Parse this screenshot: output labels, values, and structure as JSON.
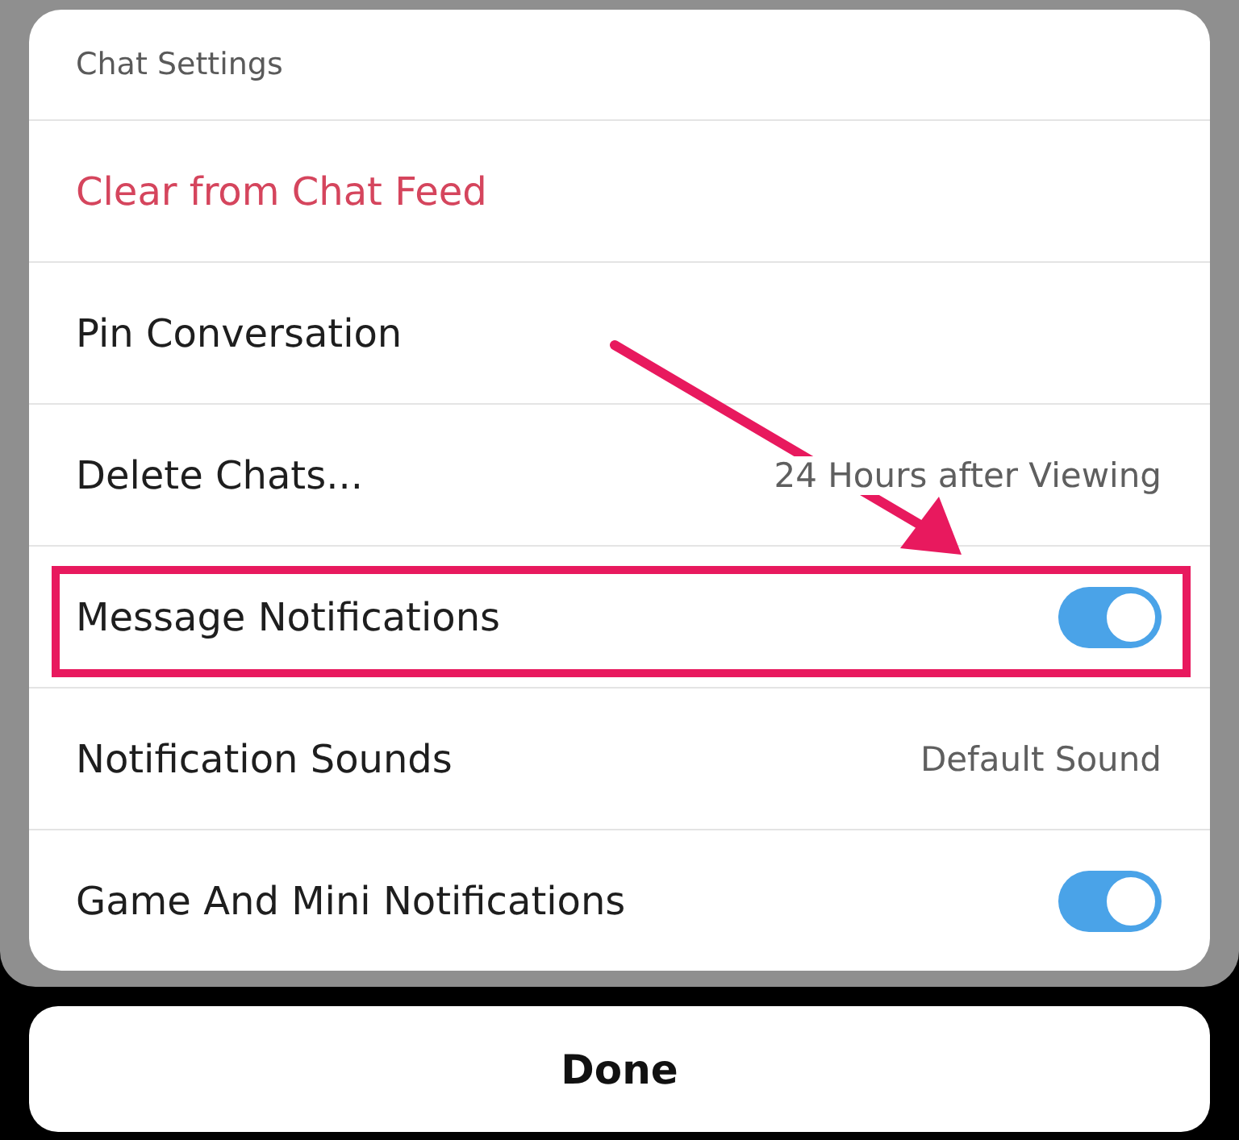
{
  "sheet": {
    "title": "Chat Settings",
    "rows": [
      {
        "kind": "action",
        "label": "Clear from Chat Feed",
        "destructive": true
      },
      {
        "kind": "action",
        "label": "Pin Conversation",
        "destructive": false
      },
      {
        "kind": "value",
        "label": "Delete Chats...",
        "value": "24 Hours after Viewing"
      },
      {
        "kind": "toggle",
        "label": "Message Notifications",
        "on": true,
        "highlighted": true
      },
      {
        "kind": "value",
        "label": "Notification Sounds",
        "value": "Default Sound"
      },
      {
        "kind": "toggle",
        "label": "Game And Mini Notifications",
        "on": true,
        "highlighted": false
      }
    ]
  },
  "done_button": {
    "label": "Done"
  }
}
